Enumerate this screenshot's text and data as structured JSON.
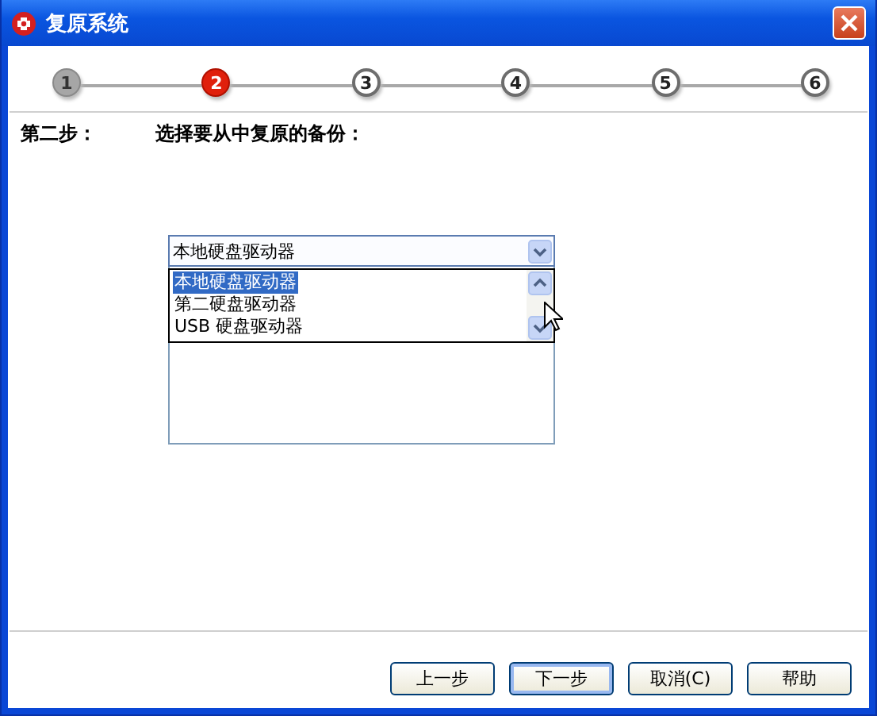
{
  "window": {
    "title": "复原系统"
  },
  "steps": [
    {
      "label": "1",
      "done": true,
      "selected": false
    },
    {
      "label": "2",
      "done": false,
      "selected": true
    },
    {
      "label": "3",
      "done": false,
      "selected": false
    },
    {
      "label": "4",
      "done": false,
      "selected": false
    },
    {
      "label": "5",
      "done": false,
      "selected": false
    },
    {
      "label": "6",
      "done": false,
      "selected": false
    }
  ],
  "step_title": "第二步：",
  "instruction": "选择要从中复原的备份：",
  "combo": {
    "value": "本地硬盘驱动器",
    "expanded": true,
    "options": [
      {
        "label": "本地硬盘驱动器",
        "selected": true
      },
      {
        "label": "第二硬盘驱动器",
        "selected": false
      },
      {
        "label": "USB 硬盘驱动器",
        "selected": false
      }
    ]
  },
  "buttons": [
    {
      "label": "上一步",
      "default": false
    },
    {
      "label": "下一步",
      "default": true
    },
    {
      "label": "取消(C)",
      "default": false
    },
    {
      "label": "帮助",
      "default": false
    }
  ]
}
